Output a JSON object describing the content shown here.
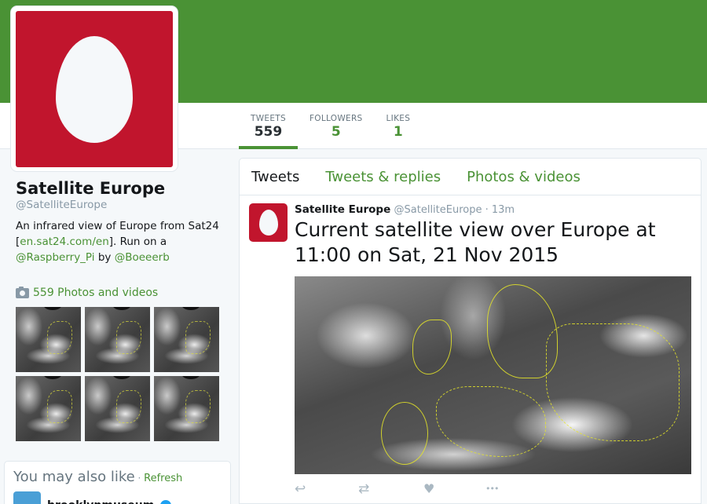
{
  "profile": {
    "name": "Satellite Europe",
    "handle": "@SatelliteEurope",
    "bio_prefix": "An infrared view of Europe from Sat24 [",
    "bio_link": "en.sat24.com/en",
    "bio_mid": "]. Run on a ",
    "bio_mention1": "@Raspberry_Pi",
    "bio_by": " by ",
    "bio_mention2": "@Boeeerb",
    "photos_label": "559 Photos and videos"
  },
  "stats": [
    {
      "label": "TWEETS",
      "value": "559"
    },
    {
      "label": "FOLLOWERS",
      "value": "5"
    },
    {
      "label": "LIKES",
      "value": "1"
    }
  ],
  "tabs": [
    "Tweets",
    "Tweets & replies",
    "Photos & videos"
  ],
  "tweet": {
    "name": "Satellite Europe",
    "handle": "@SatelliteEurope",
    "separator": " · ",
    "time": "13m",
    "text": "Current satellite view over Europe at 11:00 on Sat, 21 Nov 2015"
  },
  "wtf": {
    "title": "You may also like",
    "dot": " · ",
    "refresh": "Refresh",
    "suggestion_name": "brooklynmuseum"
  },
  "colors": {
    "brand_green": "#4a9235",
    "avatar_red": "#c1152d"
  },
  "icons": [
    "camera-icon",
    "reply-icon",
    "retweet-icon",
    "like-icon",
    "more-icon",
    "verified-icon"
  ]
}
